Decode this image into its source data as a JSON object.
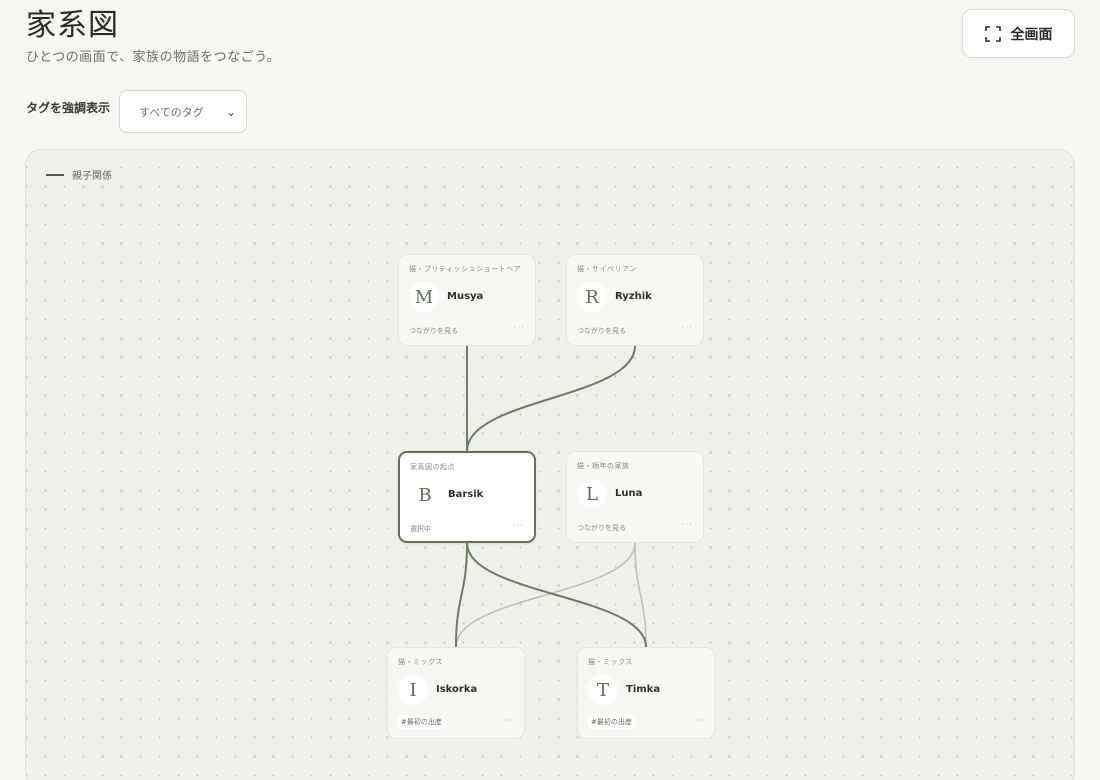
{
  "header": {
    "title": "家系図",
    "subtitle": "ひとつの画面で、家族の物語をつなごう。",
    "fullscreen_label": "全画面"
  },
  "filter": {
    "label": "タグを強調表示",
    "selected": "すべてのタグ"
  },
  "legend": {
    "parent_child": "親子関係"
  },
  "nodes": [
    {
      "id": "musya",
      "initial": "M",
      "name": "Musya",
      "tag": "猫・ブリティッシュショートヘア",
      "footer": "つながりを見る",
      "selected": false
    },
    {
      "id": "ryzhik",
      "initial": "R",
      "name": "Ryzhik",
      "tag": "猫・サイベリアン",
      "footer": "つながりを見る",
      "selected": false
    },
    {
      "id": "barsik",
      "initial": "B",
      "name": "Barsik",
      "tag": "家系図の起点",
      "footer": "選択中",
      "selected": true
    },
    {
      "id": "luna",
      "initial": "L",
      "name": "Luna",
      "tag": "猫・柄年の家族",
      "footer": "つながりを見る",
      "selected": false
    },
    {
      "id": "iskorka",
      "initial": "I",
      "name": "Iskorka",
      "tag": "猫・ミックス",
      "chip": "#最初の出産",
      "selected": false
    },
    {
      "id": "timka",
      "initial": "T",
      "name": "Timka",
      "tag": "猫・ミックス",
      "chip": "#最初の出産",
      "selected": false
    }
  ],
  "more_glyph": "···",
  "edges": [
    {
      "from": "musya",
      "to": "barsik",
      "style": "strong"
    },
    {
      "from": "ryzhik",
      "to": "barsik",
      "style": "strong"
    },
    {
      "from": "barsik",
      "to": "iskorka",
      "style": "strong"
    },
    {
      "from": "barsik",
      "to": "timka",
      "style": "strong"
    },
    {
      "from": "luna",
      "to": "iskorka",
      "style": "faint"
    },
    {
      "from": "luna",
      "to": "timka",
      "style": "faint"
    }
  ],
  "colors": {
    "strong_edge": "#6b7d60",
    "faint_edge": "#bdbfb3",
    "selected_border": "#5f7456"
  }
}
